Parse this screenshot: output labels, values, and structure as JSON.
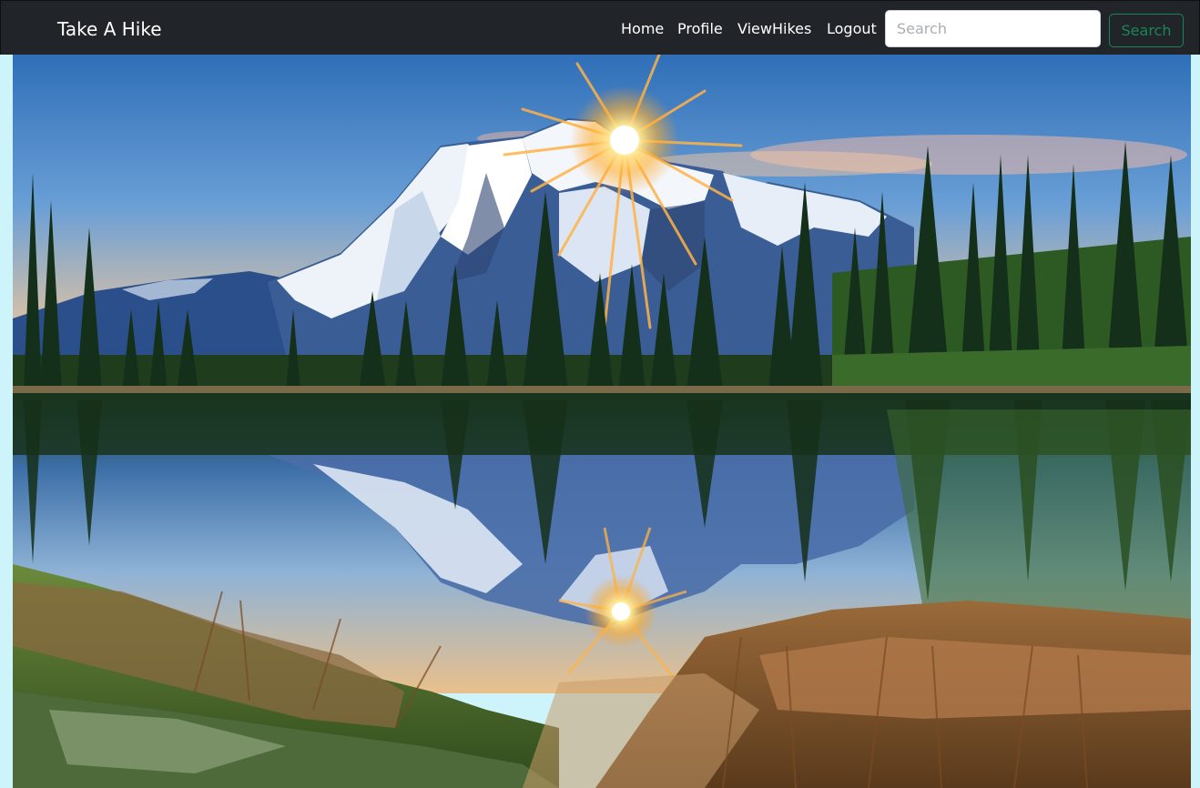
{
  "navbar": {
    "brand": "Take A Hike",
    "links": [
      {
        "label": "Home"
      },
      {
        "label": "Profile"
      },
      {
        "label": "ViewHikes"
      },
      {
        "label": "Logout"
      }
    ],
    "search": {
      "placeholder": "Search",
      "value": "",
      "button_label": "Search"
    }
  },
  "colors": {
    "navbar_bg": "#212529",
    "page_bg": "#cdf3fb",
    "search_button_accent": "#198754"
  },
  "hero": {
    "image_subject": "mountain-lake-sunrise-photo"
  }
}
